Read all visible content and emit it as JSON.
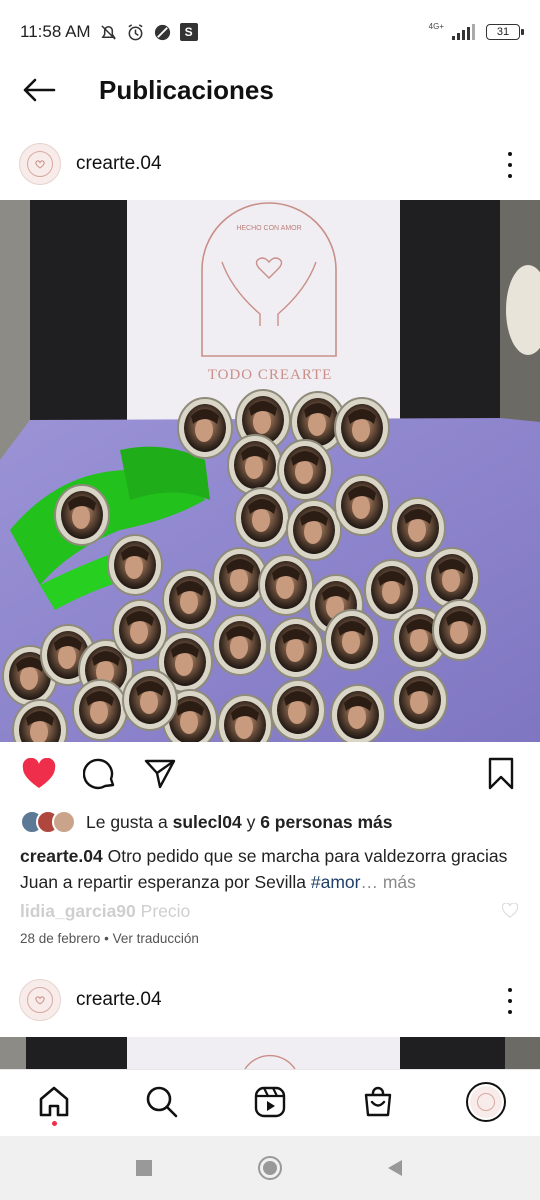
{
  "status_bar": {
    "time": "11:58 AM",
    "network_label": "4G+",
    "battery_level": "31",
    "icons": [
      "mute-icon",
      "alarm-icon",
      "dnd-icon",
      "s-app-icon",
      "signal-icon",
      "battery-icon"
    ]
  },
  "header": {
    "title": "Publicaciones"
  },
  "posts": [
    {
      "username": "crearte.04",
      "image": {
        "card_text_top": "HECHO CON AMOR",
        "card_text_main": "TODO CREARTE"
      },
      "liked": true,
      "likes": {
        "prefix": "Le gusta a",
        "first_user": "sulecl04",
        "connector": "y",
        "others": "6 personas más"
      },
      "caption": {
        "user": "crearte.04",
        "text": "Otro pedido que se marcha para valdezorra gracias Juan a repartir esperanza por Sevilla",
        "hashtag": "#amor",
        "ellipsis": "…",
        "more": "más"
      },
      "comment": {
        "user": "lidia_garcia90",
        "text": "Precio"
      },
      "date": "28 de febrero",
      "separator": "•",
      "translate": "Ver traducción"
    },
    {
      "username": "crearte.04"
    }
  ],
  "colors": {
    "like_red": "#ef2e4c",
    "hashtag": "#1f3f66",
    "purple_tray": "#8f86cf",
    "ribbon_green": "#22c11c"
  },
  "bottom_nav": [
    "home-icon",
    "search-icon",
    "reels-icon",
    "shop-icon",
    "profile-avatar"
  ],
  "system_nav": [
    "recents-button",
    "home-button",
    "back-button"
  ]
}
